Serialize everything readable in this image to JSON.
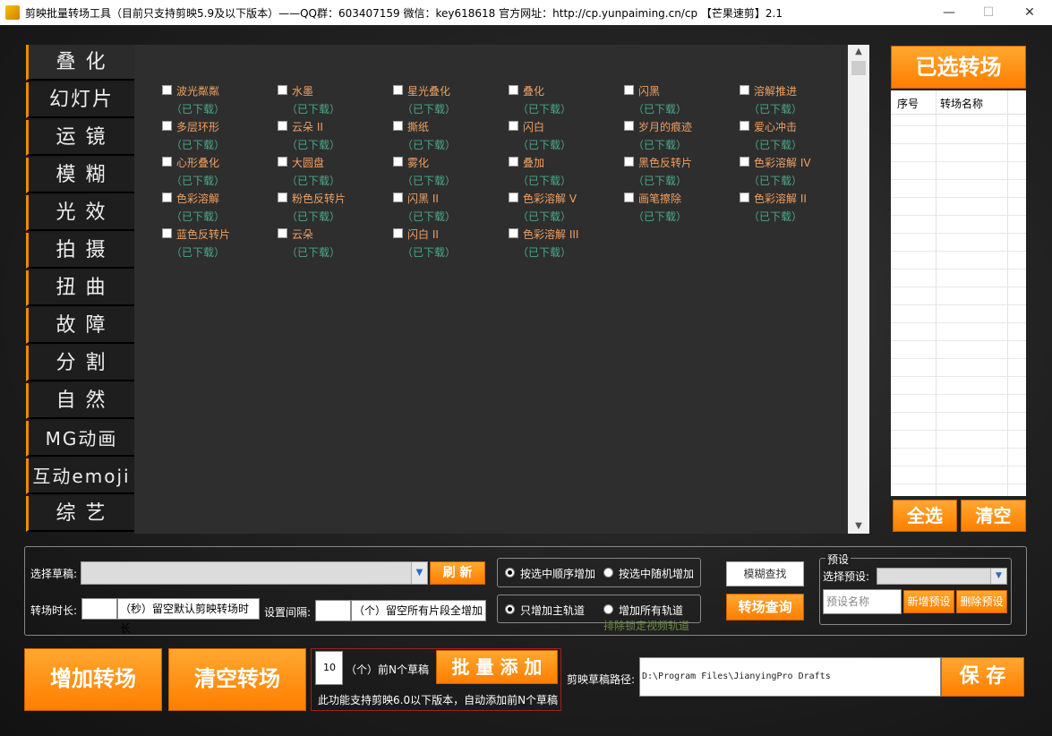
{
  "window": {
    "title": "剪映批量转场工具（目前只支持剪映5.9及以下版本）——QQ群：603407159 微信：key618618 官方网址：http://cp.yunpaiming.cn/cp 【芒果速剪】2.1",
    "min": "—",
    "max": "☐",
    "close": "✕"
  },
  "categories": [
    "叠 化",
    "幻灯片",
    "运 镜",
    "模 糊",
    "光 效",
    "拍 摄",
    "扭 曲",
    "故 障",
    "分 割",
    "自 然",
    "MG动画",
    "互动emoji",
    "综 艺"
  ],
  "transitions": [
    {
      "name": "波光粼粼",
      "status": "（已下载）"
    },
    {
      "name": "水墨",
      "status": "（已下载）"
    },
    {
      "name": "星光叠化",
      "status": "（已下载）"
    },
    {
      "name": "叠化",
      "status": "（已下载）"
    },
    {
      "name": "闪黑",
      "status": "（已下载）"
    },
    {
      "name": "溶解推进",
      "status": "（已下载）"
    },
    {
      "name": "多层环形",
      "status": "（已下载）"
    },
    {
      "name": "云朵 II",
      "status": "（已下载）"
    },
    {
      "name": "撕纸",
      "status": "（已下载）"
    },
    {
      "name": "闪白",
      "status": "（已下载）"
    },
    {
      "name": "岁月的痕迹",
      "status": "（已下载）"
    },
    {
      "name": "爱心冲击",
      "status": "（已下载）"
    },
    {
      "name": "心形叠化",
      "status": "（已下载）"
    },
    {
      "name": "大圆盘",
      "status": "（已下载）"
    },
    {
      "name": "雾化",
      "status": "（已下载）"
    },
    {
      "name": "叠加",
      "status": "（已下载）"
    },
    {
      "name": "黑色反转片",
      "status": "（已下载）"
    },
    {
      "name": "色彩溶解 IV",
      "status": "（已下载）"
    },
    {
      "name": "色彩溶解",
      "status": "（已下载）"
    },
    {
      "name": "粉色反转片",
      "status": "（已下载）"
    },
    {
      "name": "闪黑 II",
      "status": "（已下载）"
    },
    {
      "name": "色彩溶解 V",
      "status": "（已下载）"
    },
    {
      "name": "画笔擦除",
      "status": "（已下载）"
    },
    {
      "name": "色彩溶解 II",
      "status": "（已下载）"
    },
    {
      "name": "蓝色反转片",
      "status": "（已下载）"
    },
    {
      "name": "云朵",
      "status": "（已下载）"
    },
    {
      "name": "闪白 II",
      "status": "（已下载）"
    },
    {
      "name": "色彩溶解 III",
      "status": "（已下载）"
    }
  ],
  "right": {
    "selected_title": "已选转场",
    "col_index": "序号",
    "col_name": "转场名称",
    "select_all": "全选",
    "clear": "清空"
  },
  "controls": {
    "choose_draft_label": "选择草稿:",
    "refresh": "刷 新",
    "order_add": "按选中顺序增加",
    "random_add": "按选中随机增加",
    "fuzzy_find": "模糊查找",
    "preset_group": "预设",
    "choose_preset_label": "选择预设:",
    "preset_name_placeholder": "预设名称",
    "new_preset": "新增预设",
    "delete_preset": "删除预设",
    "duration_label": "转场时长:",
    "duration_hint": "（秒）留空默认剪映转场时长",
    "interval_label": "设置间隔:",
    "interval_hint": "（个）留空所有片段全增加",
    "main_track_only": "只增加主轨道",
    "all_tracks": "增加所有轨道",
    "exclude_locked": "排除锁定视频轨道",
    "query": "转场查询"
  },
  "bottom": {
    "add_transition": "增加转场",
    "clear_transition": "清空转场",
    "count_value": "10",
    "count_hint": "（个）前N个草稿",
    "batch_add": "批 量 添 加",
    "note": "此功能支持剪映6.0以下版本，自动添加前N个草稿",
    "path_label": "剪映草稿路径:",
    "path_value": "D:\\Program Files\\JianyingPro Drafts",
    "save": "保 存"
  }
}
